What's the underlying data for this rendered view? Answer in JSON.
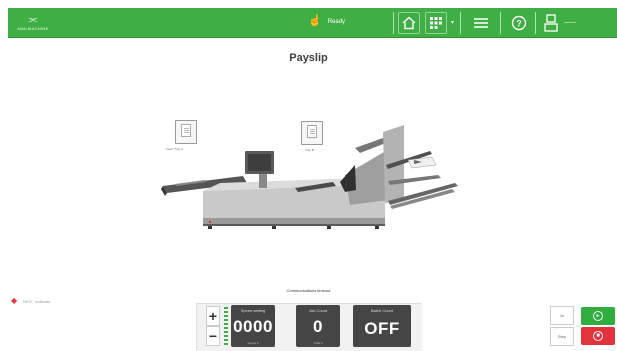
{
  "header": {
    "brand_mark": "⫘",
    "brand_text": "MAILMACHINE",
    "status_icon": "hand-pointer-icon",
    "status_text": "Ready",
    "nav_buttons": [
      "home-icon",
      "jobs-icon",
      "menu-icon",
      "help-icon",
      "user-icon"
    ],
    "user_text": "——"
  },
  "title": "Payslip",
  "trays": {
    "left_label": "Insert Tray A",
    "right_label": "Tray B"
  },
  "communications": "Communications timeout",
  "logo_text": "NEO · software",
  "counters": {
    "speed": {
      "label": "Speed setting",
      "value": "0000",
      "sub": "Speed 9"
    },
    "job": {
      "label": "Job Count",
      "value": "0",
      "sub": "Total 0"
    },
    "batch": {
      "label": "Batch Count",
      "value": "OFF",
      "sub": ""
    }
  },
  "side_buttons": [
    "1x",
    "Step"
  ],
  "actions": {
    "start_color": "#2fae3f",
    "stop_color": "#e2333d"
  },
  "accent": "#3fae45"
}
